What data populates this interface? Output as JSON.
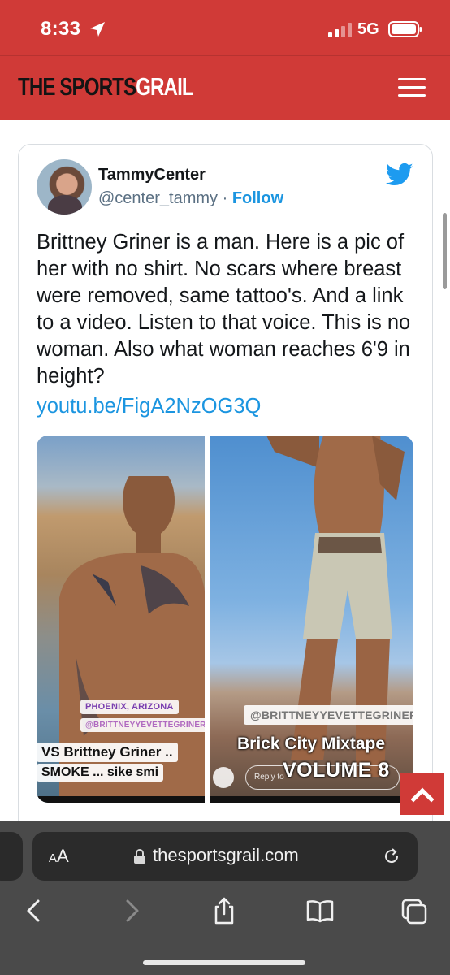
{
  "status_bar": {
    "time": "8:33",
    "network": "5G"
  },
  "site": {
    "logo_part_1": "THE SPORTS",
    "logo_part_2": "GRAIL",
    "brand_color": "#d03a37"
  },
  "tweet": {
    "user_name": "TammyCenter",
    "handle": "@center_tammy",
    "separator": "·",
    "follow_label": "Follow",
    "text": "Brittney Griner is a man. Here is a pic of her with no shirt. No scars where breast were removed, same tattoo's. And a link to a video. Listen to that voice. This is no woman. Also what woman reaches 6'9 in height?",
    "link": "youtu.be/FigA2NzOG3Q",
    "link_color": "#1b95e0",
    "media": {
      "left": {
        "location_sticker": "PHOENIX, ARIZONA",
        "username_sticker": "@BRITTNEYYEVETTEGRINER",
        "caption_line_1": "VS Brittney Griner ..",
        "caption_line_2": "SMOKE ... sike smi"
      },
      "right": {
        "username_sticker": "@BRITTNEYYEVETTEGRINER",
        "caption_line_1": "Brick City Mixtape",
        "caption_line_2": "VOLUME 8",
        "reply_placeholder": "Reply to"
      }
    }
  },
  "browser": {
    "text_size_label_small": "A",
    "text_size_label_large": "A",
    "url": "thesportsgrail.com"
  },
  "icons": {
    "location": "location-arrow-icon",
    "signal": "signal-icon",
    "battery": "battery-icon",
    "menu": "hamburger-menu-icon",
    "twitter": "twitter-bird-icon",
    "back_to_top": "chevron-up-icon",
    "lock": "lock-icon",
    "reload": "reload-icon",
    "back": "back-arrow-icon",
    "forward": "forward-arrow-icon",
    "share": "share-icon",
    "bookmarks": "bookmarks-icon",
    "tabs": "tabs-icon"
  }
}
